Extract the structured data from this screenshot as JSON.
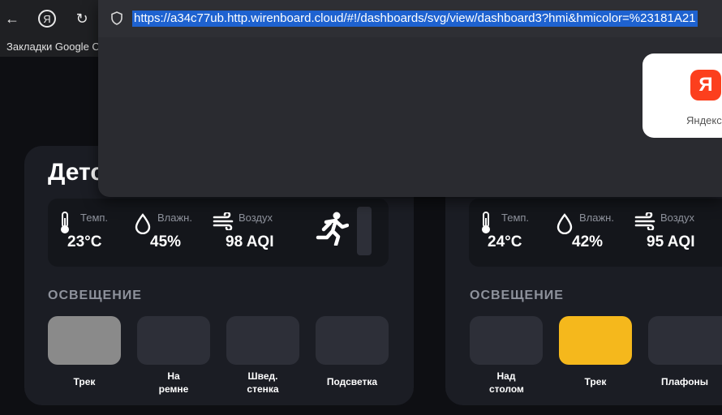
{
  "browser": {
    "back_icon": "←",
    "yandex_icon": "Я",
    "reload_icon": "↻",
    "url": "https://a34c77ub.http.wirenboard.cloud/#!/dashboards/svg/view/dashboard3?hmi&hmicolor=%23181A21",
    "bookmarks_label": "Закладки Google C",
    "tile_logo": "Я",
    "tile_label": "Яндекс"
  },
  "rooms": [
    {
      "title": "Детс",
      "sensors": {
        "temp_label": "Темп.",
        "temp_value": "23°C",
        "hum_label": "Влажн.",
        "hum_value": "45%",
        "air_label": "Воздух",
        "air_value": "98 AQI"
      },
      "lighting_title": "ОСВЕЩЕНИЕ",
      "lights": [
        {
          "label": "Трек",
          "state": "dim"
        },
        {
          "label": "На ремне",
          "state": "off"
        },
        {
          "label": "Швед. стенка",
          "state": "off"
        },
        {
          "label": "Подсветка",
          "state": "off"
        }
      ]
    },
    {
      "title": "",
      "sensors": {
        "temp_label": "Темп.",
        "temp_value": "24°C",
        "hum_label": "Влажн.",
        "hum_value": "42%",
        "air_label": "Воздух",
        "air_value": "95 AQI"
      },
      "lighting_title": "ОСВЕЩЕНИЕ",
      "lights": [
        {
          "label": "Над столом",
          "state": "off"
        },
        {
          "label": "Трек",
          "state": "on"
        },
        {
          "label": "Плафоны",
          "state": "off"
        }
      ]
    }
  ],
  "colors": {
    "accent_on": "#f5b81c",
    "card_bg": "#1b1d24",
    "url_highlight": "#1e62d0"
  }
}
